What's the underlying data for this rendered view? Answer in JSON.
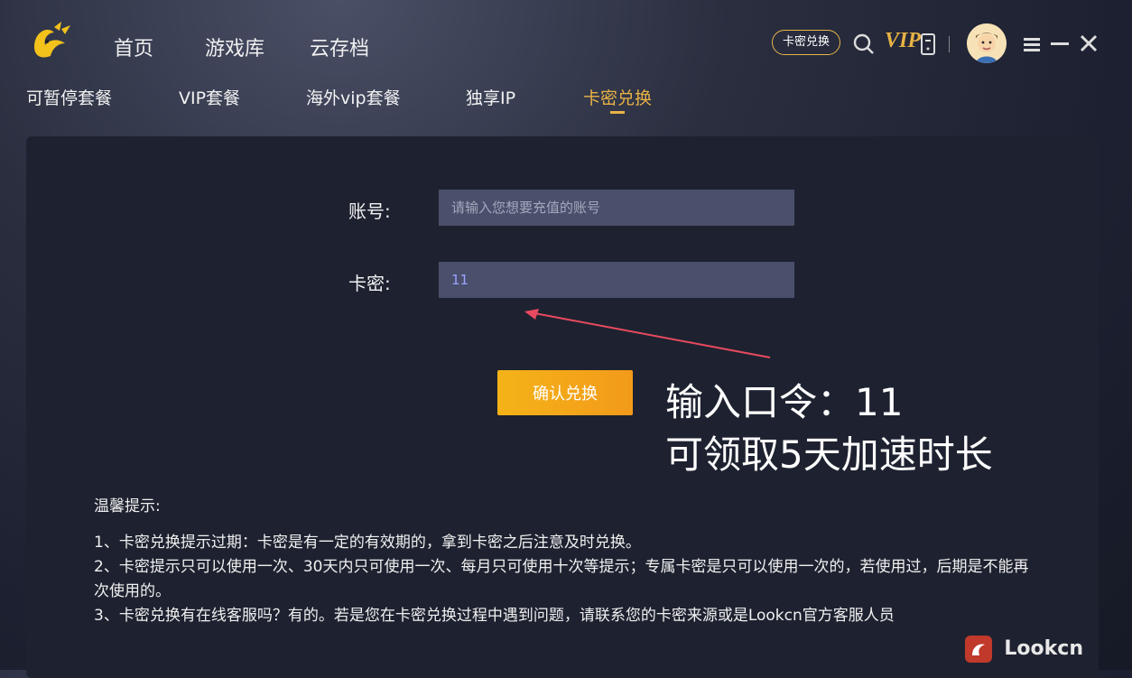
{
  "header": {
    "nav": [
      "首页",
      "游戏库",
      "云存档"
    ],
    "redeem_label": "卡密兑换",
    "vip_label": "VIP"
  },
  "subnav": {
    "items": [
      "可暂停套餐",
      "VIP套餐",
      "海外vip套餐",
      "独享IP",
      "卡密兑换"
    ],
    "active_index": 4
  },
  "form": {
    "account_label": "账号:",
    "account_placeholder": "请输入您想要充值的账号",
    "account_value": "",
    "code_label": "卡密:",
    "code_value": "11",
    "confirm_label": "确认兑换"
  },
  "annotation": {
    "line1": "输入口令：11",
    "line2": "可领取5天加速时长"
  },
  "tips": {
    "title": "温馨提示:",
    "items": [
      "1、卡密兑换提示过期：卡密是有一定的有效期的，拿到卡密之后注意及时兑换。",
      "2、卡密提示只可以使用一次、30天内只可使用一次、每月只可使用十次等提示；专属卡密是只可以使用一次的，若使用过，后期是不能再次使用的。",
      "3、卡密兑换有在线客服吗？有的。若是您在卡密兑换过程中遇到问题，请联系您的卡密来源或是Lookcn官方客服人员"
    ]
  },
  "watermark": "Lookcn",
  "colors": {
    "accent": "#e8b245",
    "button": "#f4b318",
    "panel": "#1e2230",
    "input": "#4a4f6b"
  }
}
